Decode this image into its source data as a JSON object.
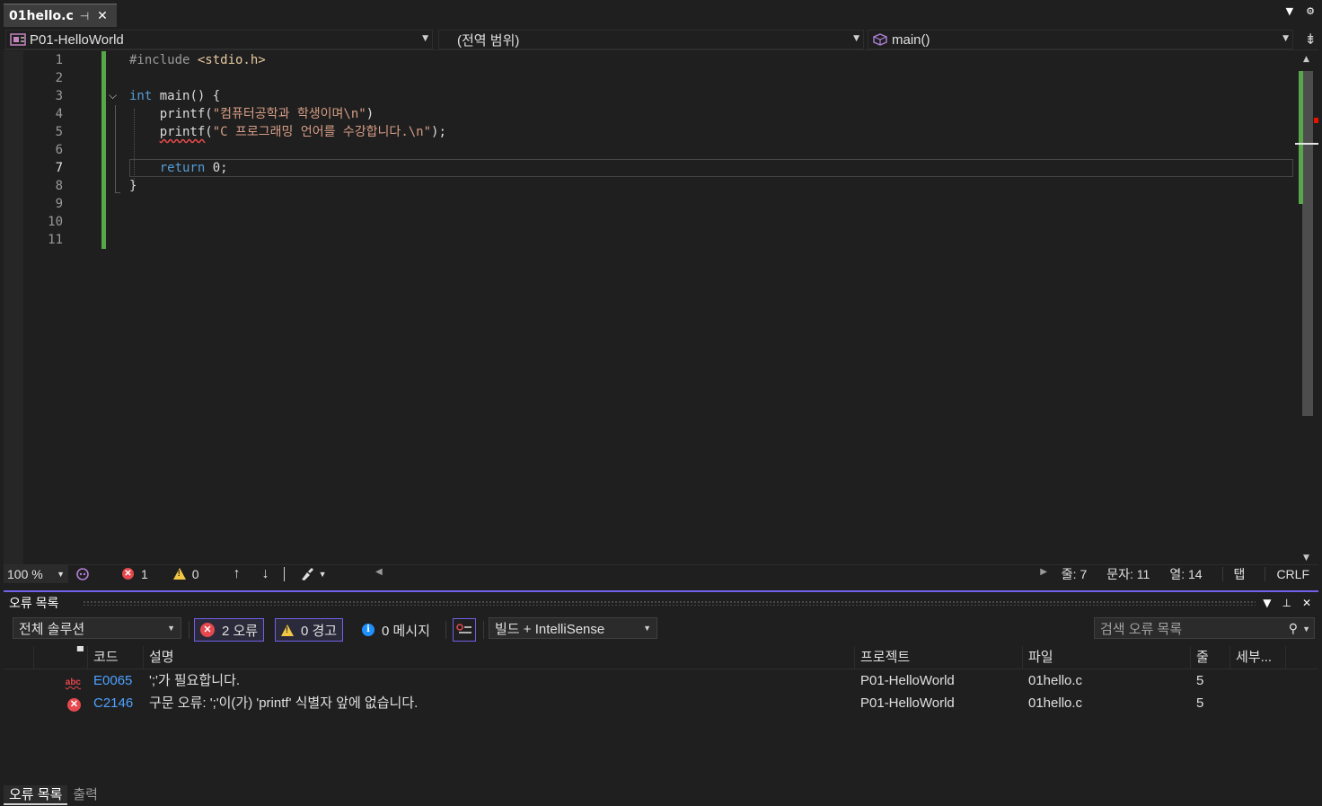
{
  "tab": {
    "title": "01hello.c"
  },
  "nav": {
    "project": "P01-HelloWorld",
    "scope": "(전역 범위)",
    "member": "main()"
  },
  "editor": {
    "line_numbers": [
      "1",
      "2",
      "3",
      "4",
      "5",
      "6",
      "7",
      "8",
      "9",
      "10",
      "11"
    ],
    "lines": {
      "l1": {
        "pre": "#include ",
        "inc": "<stdio.h>"
      },
      "l3": {
        "kw": "int",
        "rest": " main() {"
      },
      "l4": {
        "indent": "    ",
        "fn": "printf",
        "open": "(",
        "str": "\"컴퓨터공학과 학생이며\\n\"",
        "close": ")"
      },
      "l5": {
        "indent": "    ",
        "fn": "printf",
        "open": "(",
        "str": "\"C 프로그래밍 언어를 수강합니다.\\n\"",
        "close": ");"
      },
      "l7": {
        "indent": "    ",
        "kw": "return",
        "rest": " 0;"
      },
      "l8": {
        "rest": "}"
      }
    }
  },
  "status": {
    "zoom": "100 %",
    "errors": "1",
    "warnings": "0",
    "line": "줄: 7",
    "char": "문자: 11",
    "col": "열: 14",
    "tab": "탭",
    "eol": "CRLF"
  },
  "error_list": {
    "title": "오류 목록",
    "scope": "전체 솔루션",
    "errors_btn": "2 오류",
    "warnings_btn": "0 경고",
    "messages_btn": "0 메시지",
    "source": "빌드 + IntelliSense",
    "search_placeholder": "검색 오류 목록",
    "columns": {
      "code": "코드",
      "desc": "설명",
      "project": "프로젝트",
      "file": "파일",
      "line": "줄",
      "detail": "세부..."
    },
    "rows": [
      {
        "code": "E0065",
        "desc": "';'가 필요합니다.",
        "project": "P01-HelloWorld",
        "file": "01hello.c",
        "line": "5"
      },
      {
        "code": "C2146",
        "desc": "구문 오류: ';'이(가) 'printf' 식별자 앞에 없습니다.",
        "project": "P01-HelloWorld",
        "file": "01hello.c",
        "line": "5"
      }
    ]
  },
  "bottom_tabs": [
    "오류 목록",
    "출력"
  ]
}
